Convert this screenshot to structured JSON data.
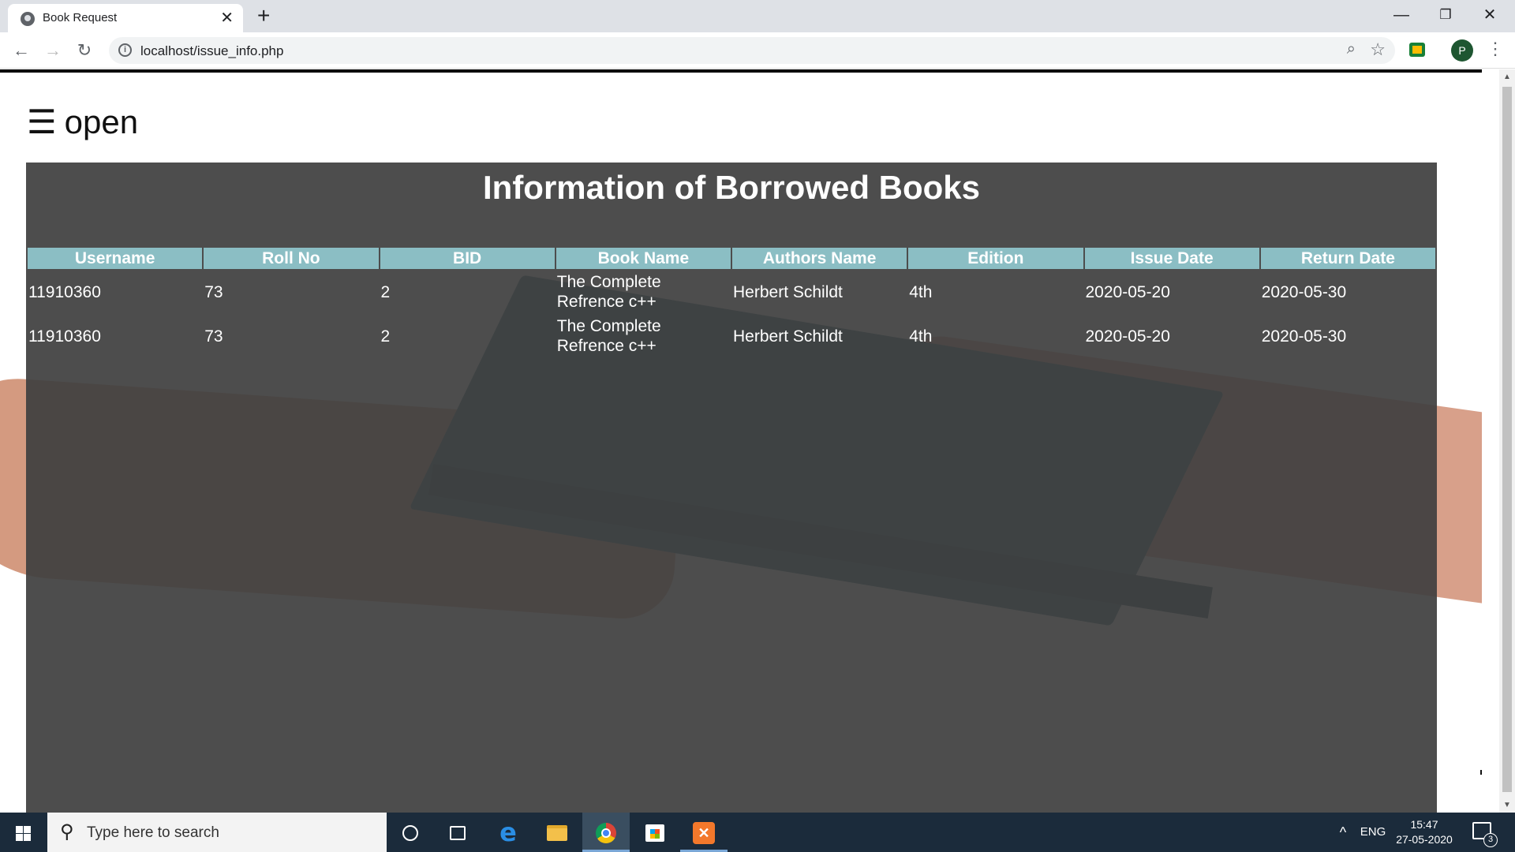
{
  "browser": {
    "tab_title": "Book Request",
    "tab_close": "✕",
    "new_tab": "+",
    "url": "localhost/issue_info.php",
    "profile_initial": "P",
    "window_controls": {
      "minimize": "—",
      "restore": "❐",
      "close": "✕"
    }
  },
  "page": {
    "opener_icon": "☰",
    "opener_label": "open",
    "heading": "Information of Borrowed Books",
    "table": {
      "columns": [
        "Username",
        "Roll No",
        "BID",
        "Book Name",
        "Authors Name",
        "Edition",
        "Issue Date",
        "Return Date"
      ],
      "rows": [
        [
          "11910360",
          "73",
          "2",
          "The Complete Refrence c++",
          "Herbert Schildt",
          "4th",
          "2020-05-20",
          "2020-05-30"
        ],
        [
          "11910360",
          "73",
          "2",
          "The Complete Refrence c++",
          "Herbert Schildt",
          "4th",
          "2020-05-20",
          "2020-05-30"
        ]
      ]
    }
  },
  "taskbar": {
    "search_placeholder": "Type here to search",
    "language": "ENG",
    "time": "15:47",
    "date": "27-05-2020",
    "notification_count": "3",
    "tray_chevron": "^"
  },
  "colors": {
    "table_header_bg": "#8bbec4",
    "overlay_bg": "#404040",
    "taskbar_bg": "#1b2b3b"
  }
}
